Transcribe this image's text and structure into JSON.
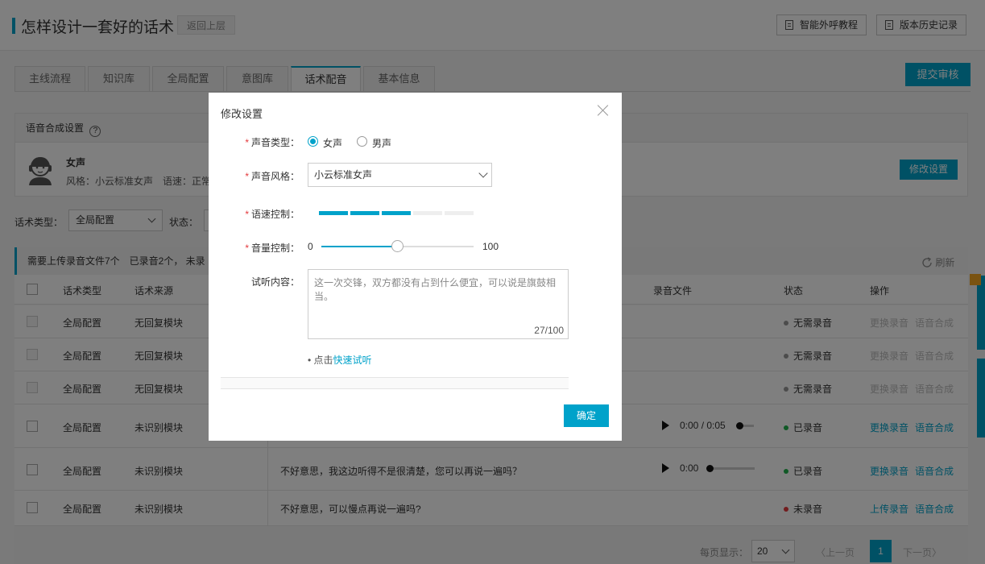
{
  "header": {
    "title": "怎样设计一套好的话术",
    "back_label": "返回上层",
    "tutorial_label": "智能外呼教程",
    "history_label": "版本历史记录"
  },
  "tabs": [
    {
      "label": "主线流程"
    },
    {
      "label": "知识库"
    },
    {
      "label": "全局配置"
    },
    {
      "label": "意图库"
    },
    {
      "label": "话术配音"
    },
    {
      "label": "基本信息"
    }
  ],
  "submit_label": "提交审核",
  "voice_panel": {
    "title": "语音合成设置",
    "help": "?",
    "voice_name": "女声",
    "voice_info": "风格：小云标准女声　语速：正常",
    "edit_label": "修改设置"
  },
  "filter": {
    "type_label": "话术类型：",
    "type_value": "全局配置",
    "status_label": "状态："
  },
  "notice": {
    "text": "需要上传录音文件7个　已录音2个，  未录",
    "refresh_label": "刷新"
  },
  "table": {
    "headers": [
      "话术类型",
      "话术来源",
      "录音文件",
      "状态",
      "操作"
    ],
    "rows": [
      {
        "type": "全局配置",
        "source": "无回复模块",
        "text": "",
        "time": "",
        "status": "无需录音",
        "status_color": "#999999",
        "op1": "更换录音",
        "op2": "语音合成"
      },
      {
        "type": "全局配置",
        "source": "无回复模块",
        "text": "",
        "time": "",
        "status": "无需录音",
        "status_color": "#999999",
        "op1": "更换录音",
        "op2": "语音合成"
      },
      {
        "type": "全局配置",
        "source": "无回复模块",
        "text": "",
        "time": "",
        "status": "无需录音",
        "status_color": "#999999",
        "op1": "更换录音",
        "op2": "语音合成"
      },
      {
        "type": "全局配置",
        "source": "未识别模块",
        "text": "",
        "time": "0:00 / 0:05",
        "status": "已录音",
        "status_color": "#21b24c",
        "op1": "更换录音",
        "op2": "语音合成"
      },
      {
        "type": "全局配置",
        "source": "未识别模块",
        "text": "不好意思，我这边听得不是很清楚，您可以再说一遍吗？",
        "time": "0:00",
        "status": "已录音",
        "status_color": "#21b24c",
        "op1": "更换录音",
        "op2": "语音合成"
      },
      {
        "type": "全局配置",
        "source": "未识别模块",
        "text": "不好意思，可以慢点再说一遍吗?",
        "time": "",
        "status": "未录音",
        "status_color": "#e4393c",
        "op1": "上传录音",
        "op2": "语音合成"
      }
    ]
  },
  "pager": {
    "size_label": "每页显示：",
    "size_value": "20",
    "prev_label": "上一页",
    "page": "1",
    "next_label": "下一页"
  },
  "modal": {
    "title": "修改设置",
    "voice_type_label": "声音类型：",
    "voice_type_options": [
      "女声",
      "男声"
    ],
    "voice_type_selected": "女声",
    "style_label": "声音风格：",
    "style_value": "小云标准女声",
    "speed_label": "语速控制：",
    "speed_level": 3,
    "speed_max": 5,
    "volume_label": "音量控制：",
    "volume_min": "0",
    "volume_max": "100",
    "volume_value": 50,
    "preview_label": "试听内容：",
    "preview_text": "这一次交锋，双方都没有占到什么便宜，可以说是旗鼓相当。",
    "preview_count": "27/100",
    "hint_prefix": "• 点击",
    "hint_link": "快速试听",
    "ok_label": "确定"
  },
  "colors": {
    "accent": "#00a2ca",
    "required": "#e4393c"
  }
}
